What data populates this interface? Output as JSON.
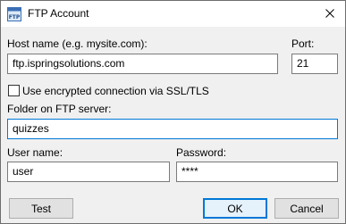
{
  "window": {
    "title": "FTP Account",
    "icon": "ftp-icon",
    "icon_text": "FTP",
    "close_icon": "close-icon"
  },
  "form": {
    "host_label": "Host name (e.g. mysite.com):",
    "host_value": "ftp.ispringsolutions.com",
    "port_label": "Port:",
    "port_value": "21",
    "ssl_label": "Use encrypted connection via SSL/TLS",
    "ssl_checked": false,
    "folder_label": "Folder on FTP server:",
    "folder_value": "quizzes",
    "user_label": "User name:",
    "user_value": "user",
    "password_label": "Password:",
    "password_value": "****"
  },
  "buttons": {
    "test": "Test",
    "ok": "OK",
    "cancel": "Cancel"
  },
  "colors": {
    "focus_border": "#0078d7",
    "window_bg": "#f0f0f0"
  }
}
